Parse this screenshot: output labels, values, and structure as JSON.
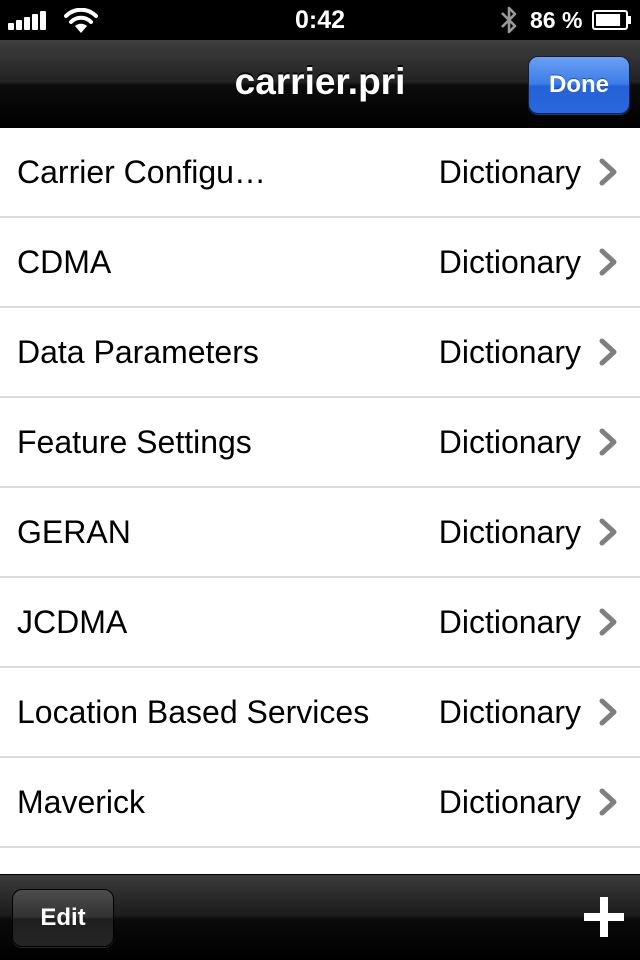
{
  "status_bar": {
    "time": "0:42",
    "battery_percent": "86 %",
    "battery_level": 0.86,
    "signal_bars": 5,
    "icons": [
      "signal-icon",
      "wifi-icon",
      "bluetooth-icon",
      "battery-icon"
    ]
  },
  "nav_bar": {
    "title": "carrier.pri",
    "done_label": "Done"
  },
  "list": {
    "items": [
      {
        "label": "Carrier Configu…",
        "type": "Dictionary"
      },
      {
        "label": "CDMA",
        "type": "Dictionary"
      },
      {
        "label": "Data Parameters",
        "type": "Dictionary"
      },
      {
        "label": "Feature Settings",
        "type": "Dictionary"
      },
      {
        "label": "GERAN",
        "type": "Dictionary"
      },
      {
        "label": "JCDMA",
        "type": "Dictionary"
      },
      {
        "label": "Location Based Services",
        "type": "Dictionary"
      },
      {
        "label": "Maverick",
        "type": "Dictionary"
      },
      {
        "label": "",
        "type": ""
      }
    ],
    "accessory_icon": "chevron-right-icon"
  },
  "toolbar": {
    "edit_label": "Edit",
    "add_icon": "plus-icon"
  },
  "colors": {
    "done_button": "#2c6be0",
    "nav_bar": "#1a1a1a",
    "row_separator": "#dcdcdc",
    "chevron": "#7f7f7f"
  }
}
